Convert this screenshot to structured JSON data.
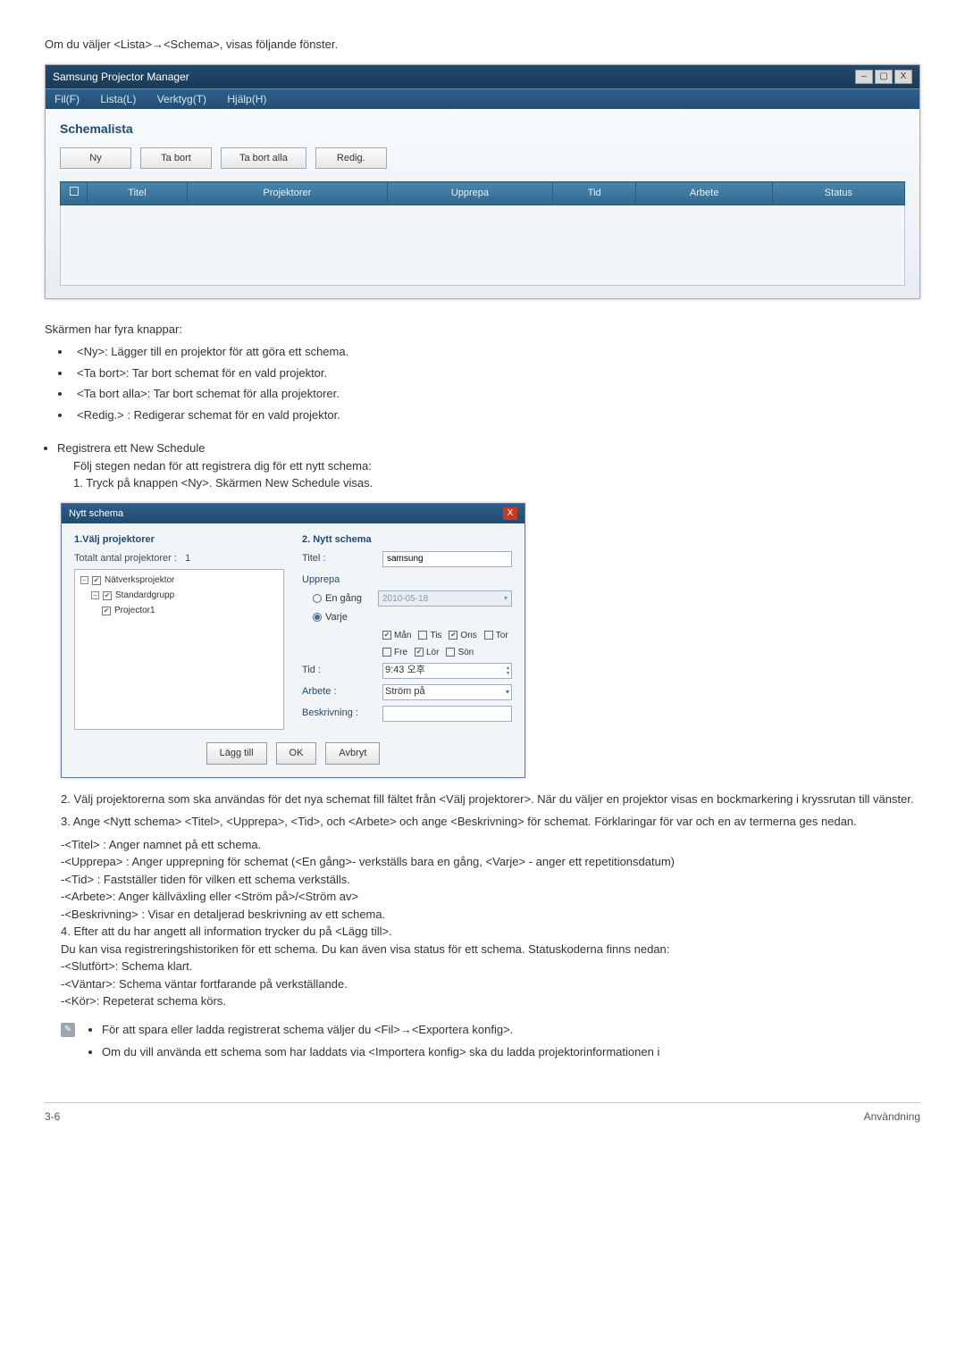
{
  "intro": "Om du väljer <Lista>→<Schema>, visas följande fönster.",
  "app_window": {
    "title": "Samsung Projector Manager",
    "win_controls": {
      "min": "–",
      "max": "▢",
      "close": "X"
    },
    "menu": {
      "file": "Fil(F)",
      "list": "Lista(L)",
      "tools": "Verktyg(T)",
      "help": "Hjälp(H)"
    },
    "pane_title": "Schemalista",
    "buttons": {
      "new": "Ny",
      "delete": "Ta bort",
      "delete_all": "Ta bort alla",
      "edit": "Redig."
    },
    "columns": {
      "check": "",
      "title": "Titel",
      "projectors": "Projektorer",
      "repeat": "Upprepa",
      "time": "Tid",
      "work": "Arbete",
      "status": "Status"
    }
  },
  "buttons_caption": "Skärmen har fyra knappar:",
  "button_list": [
    "<Ny>: Lägger till en projektor för att göra ett schema.",
    "<Ta bort>: Tar bort schemat för en vald projektor.",
    "<Ta bort alla>: Tar bort schemat för alla projektorer.",
    "<Redig.> : Redigerar schemat för en vald projektor."
  ],
  "register_heading": "Registrera ett New Schedule",
  "register_intro": "Följ stegen nedan för att registrera dig för ett nytt schema:",
  "step1": "1. Tryck på knappen <Ny>. Skärmen New Schedule visas.",
  "dialog": {
    "title": "Nytt schema",
    "close": "X",
    "col1": {
      "heading": "1.Välj projektorer",
      "total_label": "Totalt antal projektorer :",
      "total_value": "1",
      "tree": [
        {
          "level": 0,
          "checked": true,
          "exp": "–",
          "label": "Nätverksprojektor"
        },
        {
          "level": 1,
          "checked": true,
          "exp": "–",
          "label": "Standardgrupp"
        },
        {
          "level": 2,
          "checked": true,
          "exp": "",
          "label": "Projector1"
        }
      ]
    },
    "col2": {
      "heading": "2. Nytt schema",
      "title_label": "Titel :",
      "title_value": "samsung",
      "repeat_label": "Upprepa",
      "once_label": "En gång",
      "once_value": "2010-05-18",
      "each_label": "Varje",
      "days": {
        "mon": {
          "label": "Mån",
          "checked": true
        },
        "tue": {
          "label": "Tis",
          "checked": false
        },
        "wed": {
          "label": "Ons",
          "checked": true
        },
        "thu": {
          "label": "Tor",
          "checked": false
        },
        "fri": {
          "label": "Fre",
          "checked": false
        },
        "sat": {
          "label": "Lör",
          "checked": true
        },
        "sun": {
          "label": "Sön",
          "checked": false
        }
      },
      "time_label": "Tid :",
      "time_value": "9:43 오후",
      "work_label": "Arbete :",
      "work_value": "Ström på",
      "desc_label": "Beskrivning :",
      "desc_value": ""
    },
    "footer": {
      "add": "Lägg till",
      "ok": "OK",
      "cancel": "Avbryt"
    }
  },
  "step2": "2. Välj projektorerna som ska användas för det nya schemat fill fältet från <Välj projektorer>. När du väljer en projektor visas en bockmarkering i kryssrutan till vänster.",
  "step3": "3. Ange <Nytt schema> <Titel>, <Upprepa>, <Tid>, och <Arbete> och ange <Beskrivning> för schemat. Förklaringar för var och en av termerna ges nedan.",
  "defs": {
    "title": "-<Titel> : Anger namnet på ett schema.",
    "repeat": "-<Upprepa> : Anger upprepning för schemat (<En gång>- verkställs bara en gång, <Varje> - anger ett repetitionsdatum)",
    "time": "-<Tid> : Fastställer tiden för vilken ett schema verkställs.",
    "work": "-<Arbete>: Anger källväxling eller <Ström på>/<Ström av>",
    "desc": "-<Beskrivning> : Visar en detaljerad beskrivning av ett schema."
  },
  "step4_a": "4. Efter att du har angett all information trycker du på <Lägg till>.",
  "step4_b": "Du kan visa registreringshistoriken för ett schema. Du kan även visa status för ett schema. Statuskoderna finns nedan:",
  "status": {
    "done": "-<Slutfört>: Schema klart.",
    "wait": "-<Väntar>: Schema väntar fortfarande på verkställande.",
    "run": "-<Kör>: Repeterat schema körs."
  },
  "note": {
    "items": [
      "För att spara eller ladda registrerat schema väljer du <Fil>→<Exportera konfig>.",
      "Om du vill använda ett schema som har laddats via <Importera konfig> ska du ladda projektorinformationen i"
    ]
  },
  "footer": {
    "left": "3-6",
    "right": "Användning"
  }
}
